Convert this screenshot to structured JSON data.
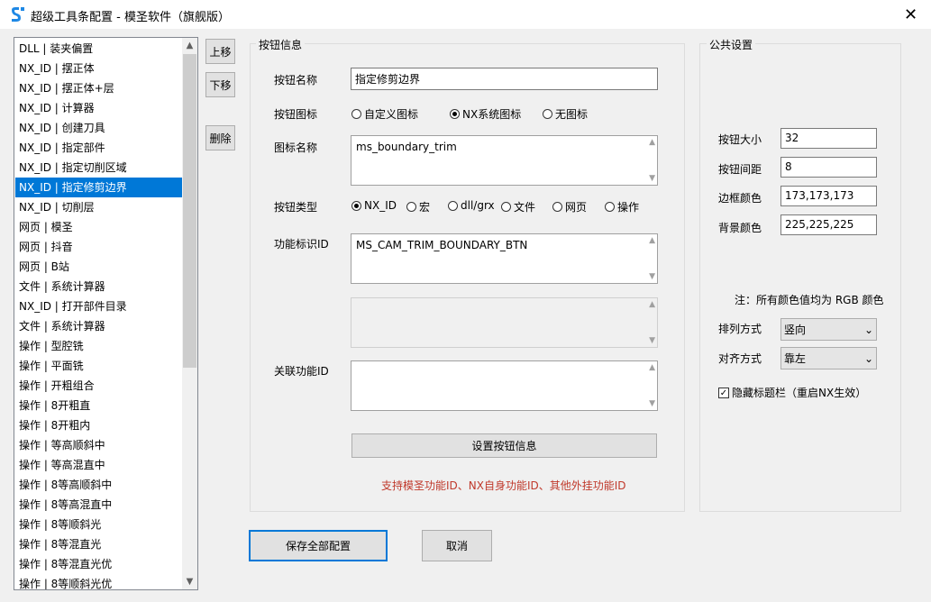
{
  "window": {
    "title": "超级工具条配置 - 模圣软件（旗舰版）",
    "close": "✕"
  },
  "list": {
    "items": [
      "DLL | 装夹偏置",
      "NX_ID | 摆正体",
      "NX_ID | 摆正体+层",
      "NX_ID | 计算器",
      "NX_ID | 创建刀具",
      "NX_ID | 指定部件",
      "NX_ID | 指定切削区域",
      "NX_ID | 指定修剪边界",
      "NX_ID | 切削层",
      "网页 | 模圣",
      "网页 | 抖音",
      "网页 | B站",
      "文件 | 系统计算器",
      "NX_ID | 打开部件目录",
      "文件 | 系统计算器",
      "操作 | 型腔铣",
      "操作 | 平面铣",
      "操作 | 开粗组合",
      "操作 | 8开粗直",
      "操作 | 8开粗内",
      "操作 | 等高顺斜中",
      "操作 | 等高混直中",
      "操作 | 8等高顺斜中",
      "操作 | 8等高混直中",
      "操作 | 8等顺斜光",
      "操作 | 8等混直光",
      "操作 | 8等混直光优",
      "操作 | 8等顺斜光优"
    ],
    "selected_index": 7
  },
  "side_buttons": {
    "up": "上移",
    "down": "下移",
    "delete": "删除"
  },
  "button_info": {
    "group_title": "按钮信息",
    "name_label": "按钮名称",
    "name_value": "指定修剪边界",
    "icon_label": "按钮图标",
    "icon_options": [
      "自定义图标",
      "NX系统图标",
      "无图标"
    ],
    "icon_selected": 1,
    "icon_name_label": "图标名称",
    "icon_name_value": "ms_boundary_trim",
    "type_label": "按钮类型",
    "type_options": [
      "NX_ID",
      "宏",
      "dll/grx",
      "文件",
      "网页",
      "操作"
    ],
    "type_selected": 0,
    "func_id_label": "功能标识ID",
    "func_id_value": "MS_CAM_TRIM_BOUNDARY_BTN",
    "related_id_label": "关联功能ID",
    "related_id_value": "",
    "set_button": "设置按钮信息",
    "note": "支持模圣功能ID、NX自身功能ID、其他外挂功能ID"
  },
  "public_settings": {
    "group_title": "公共设置",
    "size_label": "按钮大小",
    "size_value": "32",
    "spacing_label": "按钮间距",
    "spacing_value": "8",
    "border_color_label": "边框颜色",
    "border_color_value": "173,173,173",
    "bg_color_label": "背景颜色",
    "bg_color_value": "225,225,225",
    "color_note": "注：所有颜色值均为 RGB 颜色",
    "arrange_label": "排列方式",
    "arrange_value": "竖向",
    "align_label": "对齐方式",
    "align_value": "靠左",
    "hide_title_label": "隐藏标题栏（重启NX生效）",
    "hide_title_checked": true
  },
  "footer": {
    "save": "保存全部配置",
    "cancel": "取消"
  },
  "colors": {
    "selection": "#0078d7",
    "note": "#c0392b",
    "accent_border": "#0078d7"
  }
}
